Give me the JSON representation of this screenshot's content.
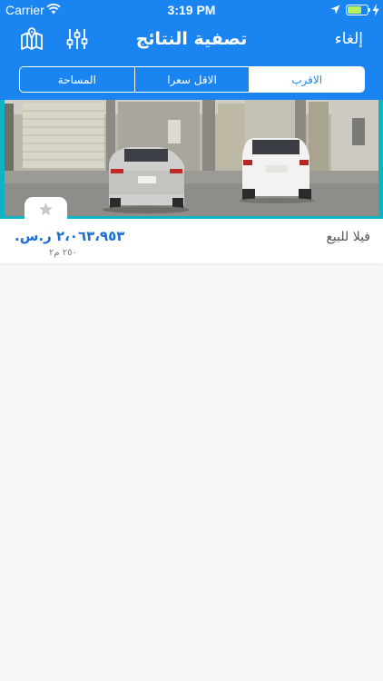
{
  "status_bar": {
    "carrier": "Carrier",
    "time": "3:19 PM",
    "battery_level": 0.8,
    "battery_color": "#b8f05a"
  },
  "nav": {
    "title": "تصفية النتائج",
    "cancel_label": "إلغاء",
    "left_icons": [
      "map-icon",
      "filter-sliders-icon"
    ]
  },
  "sort_tabs": {
    "items": [
      {
        "label": "المساحة",
        "selected": false
      },
      {
        "label": "الاقل سعرا",
        "selected": false
      },
      {
        "label": "الاقرب",
        "selected": true
      }
    ]
  },
  "listing": {
    "type": "فيلا للبيع",
    "price": "٢،٠٦٣،٩٥٣ ر.س.",
    "area": "٢٥٠ م٢",
    "favorite_icon": "star-icon"
  },
  "colors": {
    "primary": "#1a85f0",
    "accent_teal": "#0fb3c3",
    "price_text": "#1a6fd0"
  }
}
